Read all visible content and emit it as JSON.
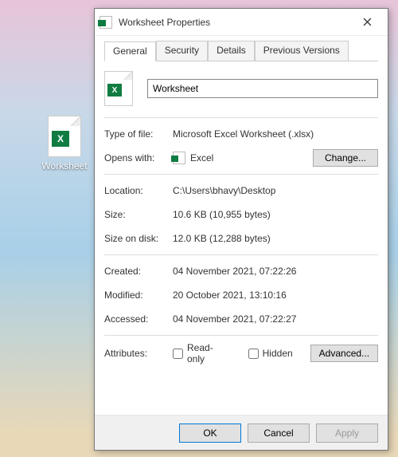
{
  "desktop": {
    "icon_label": "Worksheet"
  },
  "dialog": {
    "title": "Worksheet Properties",
    "tabs": {
      "general": "General",
      "security": "Security",
      "details": "Details",
      "previous": "Previous Versions"
    },
    "filename": "Worksheet",
    "labels": {
      "type": "Type of file:",
      "opens": "Opens with:",
      "location": "Location:",
      "size": "Size:",
      "sizeondisk": "Size on disk:",
      "created": "Created:",
      "modified": "Modified:",
      "accessed": "Accessed:",
      "attributes": "Attributes:"
    },
    "values": {
      "type": "Microsoft Excel Worksheet (.xlsx)",
      "opens": "Excel",
      "location": "C:\\Users\\bhavy\\Desktop",
      "size": "10.6 KB (10,955 bytes)",
      "sizeondisk": "12.0 KB (12,288 bytes)",
      "created": "04 November 2021, 07:22:26",
      "modified": "20 October 2021, 13:10:16",
      "accessed": "04 November 2021, 07:22:27"
    },
    "buttons": {
      "change": "Change...",
      "advanced": "Advanced...",
      "ok": "OK",
      "cancel": "Cancel",
      "apply": "Apply"
    },
    "attrs": {
      "readonly": "Read-only",
      "hidden": "Hidden"
    }
  }
}
